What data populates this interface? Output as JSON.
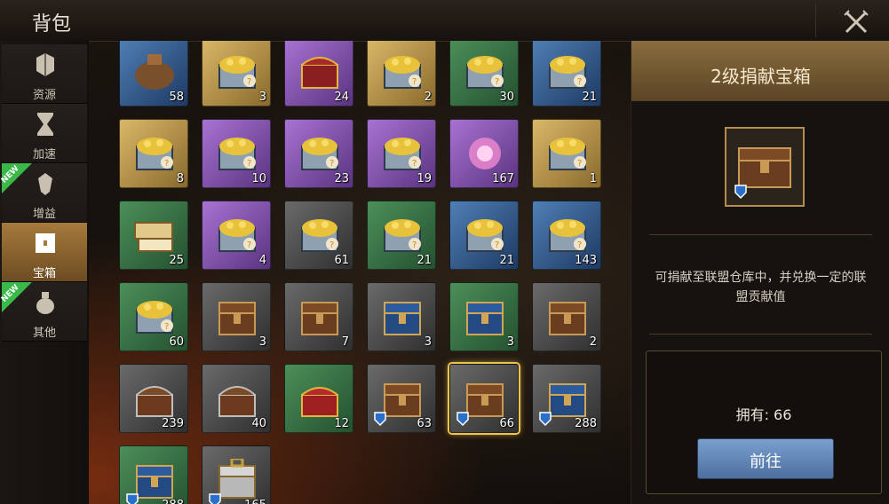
{
  "header": {
    "title": "背包"
  },
  "sidebar": {
    "tabs": [
      {
        "label": "资源",
        "icon": "cube-icon",
        "new": false,
        "active": false
      },
      {
        "label": "加速",
        "icon": "hourglass-icon",
        "new": false,
        "active": false
      },
      {
        "label": "增益",
        "icon": "crest-icon",
        "new": true,
        "active": false
      },
      {
        "label": "宝箱",
        "icon": "chest-icon",
        "new": false,
        "active": true
      },
      {
        "label": "其他",
        "icon": "bag-icon",
        "new": true,
        "active": false
      }
    ],
    "new_label": "NEW"
  },
  "items": [
    {
      "type": "sack",
      "bg": "blue",
      "count": "58"
    },
    {
      "type": "gold-chest",
      "bg": "gold",
      "count": "3"
    },
    {
      "type": "ornate-chest",
      "bg": "purple",
      "count": "24"
    },
    {
      "type": "gold-chest",
      "bg": "gold",
      "count": "2"
    },
    {
      "type": "gold-chest",
      "bg": "green",
      "count": "30"
    },
    {
      "type": "gold-chest",
      "bg": "blue",
      "count": "21"
    },
    {
      "type": "gold-chest",
      "bg": "gold",
      "count": "8"
    },
    {
      "type": "gold-chest",
      "bg": "purple",
      "count": "10"
    },
    {
      "type": "gold-chest",
      "bg": "purple",
      "count": "23"
    },
    {
      "type": "gold-chest",
      "bg": "purple",
      "count": "19"
    },
    {
      "type": "pink-burst",
      "bg": "purple",
      "count": "167"
    },
    {
      "type": "gold-chest",
      "bg": "gold",
      "count": "1"
    },
    {
      "type": "book-chest",
      "bg": "green",
      "count": "25"
    },
    {
      "type": "gold-chest",
      "bg": "purple",
      "count": "4"
    },
    {
      "type": "gold-chest",
      "bg": "gray",
      "count": "61"
    },
    {
      "type": "gold-chest",
      "bg": "green",
      "count": "21"
    },
    {
      "type": "gold-chest",
      "bg": "blue",
      "count": "21"
    },
    {
      "type": "gold-chest",
      "bg": "blue",
      "count": "143"
    },
    {
      "type": "gold-chest",
      "bg": "green",
      "count": "60"
    },
    {
      "type": "wood-chest",
      "bg": "gray",
      "count": "3"
    },
    {
      "type": "wood-chest",
      "bg": "gray",
      "count": "7"
    },
    {
      "type": "blue-chest",
      "bg": "gray",
      "count": "3"
    },
    {
      "type": "blue-chest",
      "bg": "green",
      "count": "3"
    },
    {
      "type": "wood-chest",
      "bg": "gray",
      "count": "2"
    },
    {
      "type": "round-chest",
      "bg": "gray",
      "count": "239"
    },
    {
      "type": "round-chest",
      "bg": "gray",
      "count": "40"
    },
    {
      "type": "red-chest",
      "bg": "green",
      "count": "12"
    },
    {
      "type": "wood-chest",
      "bg": "gray",
      "count": "63",
      "badge": true
    },
    {
      "type": "wood-chest",
      "bg": "gray",
      "count": "66",
      "badge": true,
      "selected": true
    },
    {
      "type": "blue-chest",
      "bg": "gray",
      "count": "288",
      "badge": true
    },
    {
      "type": "blue-chest",
      "bg": "green",
      "count": "288",
      "badge": true
    },
    {
      "type": "silver-chest",
      "bg": "gray",
      "count": "165",
      "badge": true
    }
  ],
  "detail": {
    "title": "2级捐献宝箱",
    "description": "可捐献至联盟仓库中，并兑换一定的联盟贡献值",
    "owned": "拥有: 66",
    "go_button": "前往"
  },
  "colors": {
    "accent": "#f0c34a",
    "button": "#6b8fc0",
    "new_tag": "#3ab94a"
  }
}
